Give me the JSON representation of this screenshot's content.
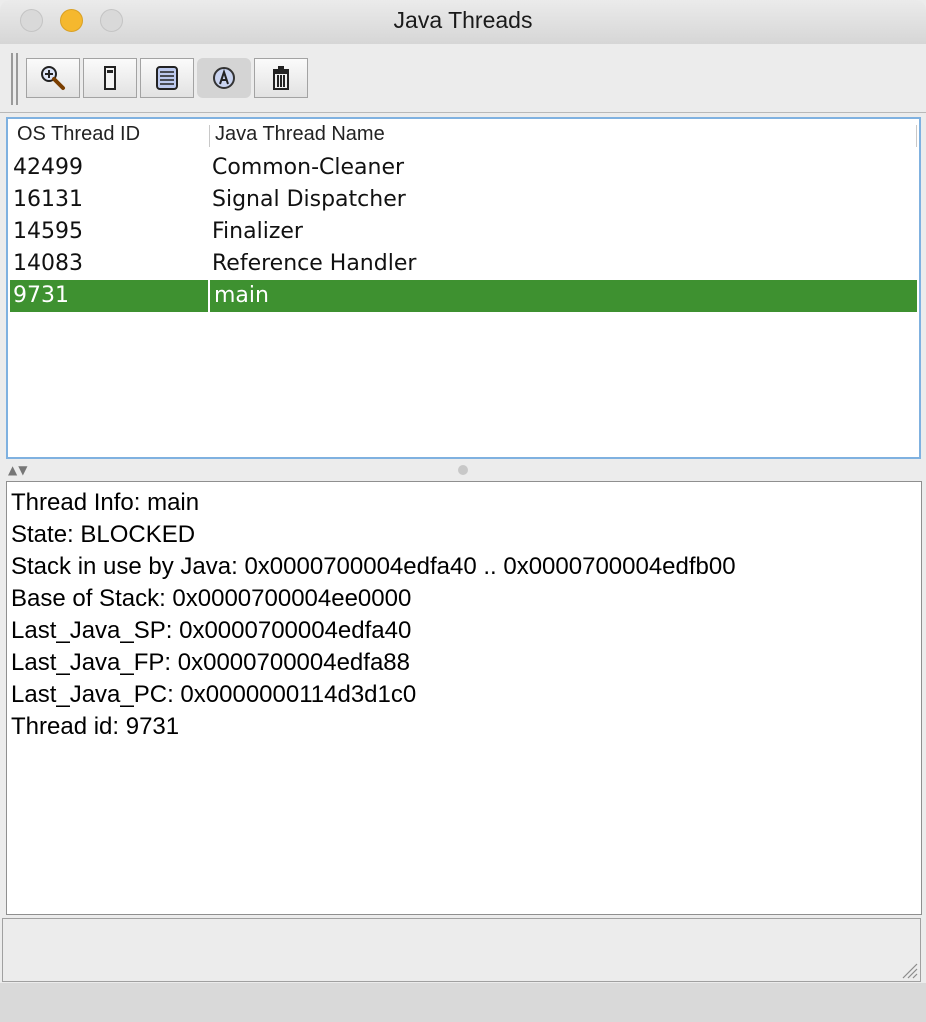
{
  "window": {
    "title": "Java Threads"
  },
  "toolbar": {
    "buttons": [
      {
        "icon": "magnifier-icon"
      },
      {
        "icon": "single-frame-icon"
      },
      {
        "icon": "stack-icon"
      },
      {
        "icon": "lock-badge-icon",
        "pressed": true
      },
      {
        "icon": "trash-icon"
      }
    ]
  },
  "table": {
    "columns": [
      "OS Thread ID",
      "Java Thread Name"
    ],
    "rows": [
      {
        "id": "42499",
        "name": "Common-Cleaner"
      },
      {
        "id": "16131",
        "name": "Signal Dispatcher"
      },
      {
        "id": "14595",
        "name": "Finalizer"
      },
      {
        "id": "14083",
        "name": "Reference Handler"
      },
      {
        "id": "9731",
        "name": "main",
        "selected": true
      }
    ]
  },
  "info": {
    "lines": [
      "Thread Info: main",
      "State: BLOCKED",
      "Stack in use by Java: 0x0000700004edfa40 .. 0x0000700004edfb00",
      "Base of Stack: 0x0000700004ee0000",
      "Last_Java_SP: 0x0000700004edfa40",
      "Last_Java_FP: 0x0000700004edfa88",
      "Last_Java_PC: 0x0000000114d3d1c0",
      "Thread id: 9731"
    ]
  },
  "colors": {
    "selection": "#3e9130",
    "focus_border": "#7fb1e0"
  }
}
